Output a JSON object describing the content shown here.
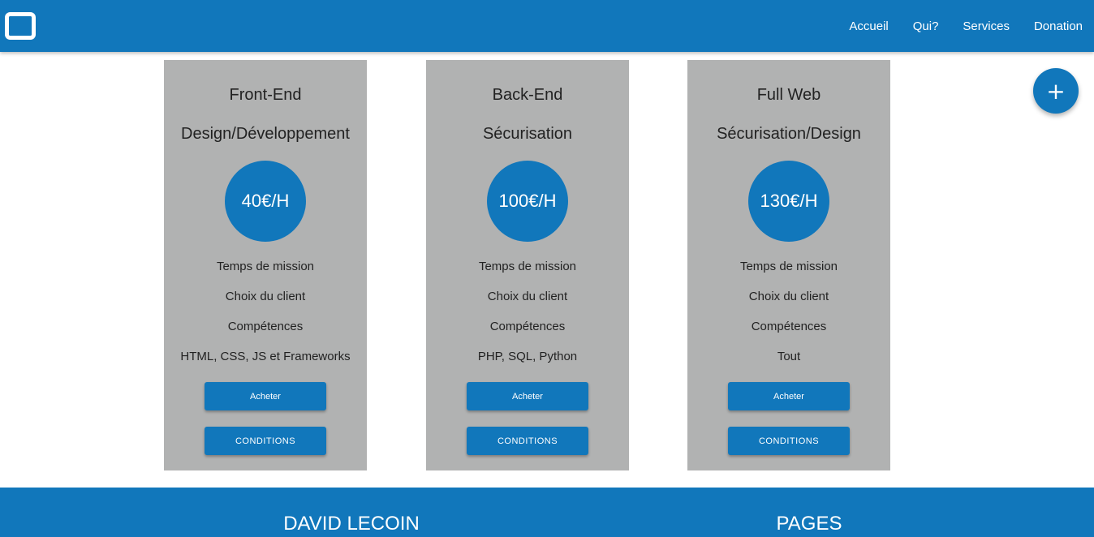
{
  "navbar": {
    "logo_icon": "window-icon",
    "links": [
      {
        "label": "Accueil"
      },
      {
        "label": "Qui?"
      },
      {
        "label": "Services"
      },
      {
        "label": "Donation"
      }
    ]
  },
  "cards": [
    {
      "title": "Front-End",
      "subtitle": "Design/Développement",
      "price": "40€/H",
      "features": [
        "Temps de mission",
        "Choix du client",
        "Compétences",
        "HTML, CSS, JS et Frameworks"
      ],
      "buy_label": "Acheter",
      "conditions_label": "CONDITIONS"
    },
    {
      "title": "Back-End",
      "subtitle": "Sécurisation",
      "price": "100€/H",
      "features": [
        "Temps de mission",
        "Choix du client",
        "Compétences",
        "PHP, SQL, Python"
      ],
      "buy_label": "Acheter",
      "conditions_label": "CONDITIONS"
    },
    {
      "title": "Full Web",
      "subtitle": "Sécurisation/Design",
      "price": "130€/H",
      "features": [
        "Temps de mission",
        "Choix du client",
        "Compétences",
        "Tout"
      ],
      "buy_label": "Acheter",
      "conditions_label": "CONDITIONS"
    }
  ],
  "fab": {
    "label": "+",
    "icon": "plus-icon"
  },
  "footer": {
    "left_heading": "DAVID LECOIN",
    "right_heading": "PAGES"
  },
  "colors": {
    "primary": "#1177bb",
    "card_bg": "#b1b2b2",
    "text": "#222222",
    "on_primary": "#ffffff"
  }
}
